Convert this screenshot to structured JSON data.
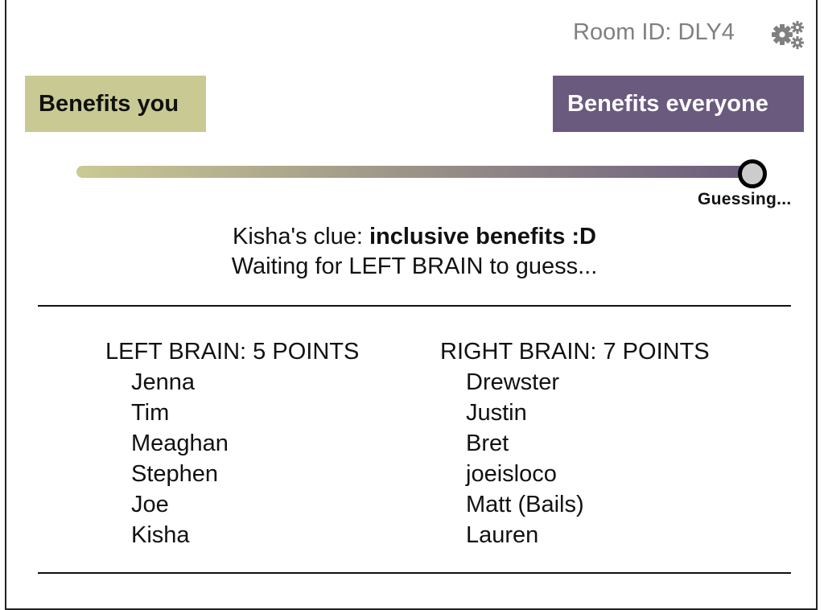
{
  "header": {
    "room_id": "Room ID: DLY4",
    "settings_icon": "gears-icon"
  },
  "spectrum": {
    "left_label": "Benefits you",
    "right_label": "Benefits everyone",
    "left_color": "#c9c994",
    "right_color": "#6a5a7e",
    "guess_position": 0.96,
    "status": "Guessing..."
  },
  "clue": {
    "prefix": "Kisha's clue: ",
    "text": "inclusive benefits :D",
    "waiting": "Waiting for LEFT BRAIN to guess..."
  },
  "teams": [
    {
      "title": "LEFT BRAIN: 5 POINTS",
      "players": [
        "Jenna",
        "Tim",
        "Meaghan",
        "Stephen",
        "Joe",
        "Kisha"
      ]
    },
    {
      "title": "RIGHT BRAIN: 7 POINTS",
      "players": [
        "Drewster",
        "Justin",
        "Bret",
        "joeisloco",
        "Matt (Bails)",
        "Lauren"
      ]
    }
  ]
}
